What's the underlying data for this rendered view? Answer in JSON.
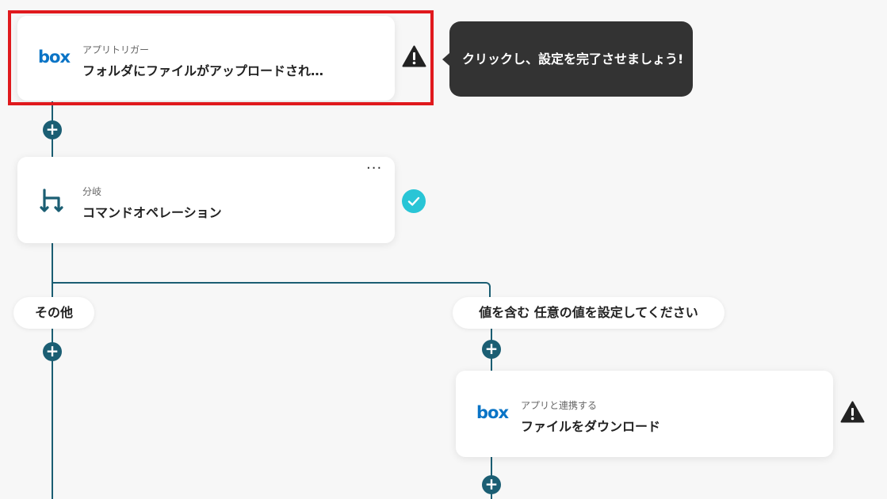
{
  "trigger_card": {
    "logo": "box",
    "subtitle": "アプリトリガー",
    "title": "フォルダにファイルがアップロードされ…"
  },
  "tooltip": {
    "text": "クリックし、設定を完了させましょう!"
  },
  "branch_card": {
    "icon": "branch-icon",
    "subtitle": "分岐",
    "title": "コマンドオペレーション",
    "menu": "···"
  },
  "branches": {
    "left_label": "その他",
    "right_label": "値を含む 任意の値を設定してください"
  },
  "download_card": {
    "logo": "box",
    "subtitle": "アプリと連携する",
    "title": "ファイルをダウンロード"
  },
  "add_step": "+",
  "colors": {
    "line": "#1b5e73",
    "box_brand": "#0a74c6",
    "warning": "#222222",
    "check": "#29c5d6",
    "highlight": "#e0191d",
    "tooltip_bg": "#333333"
  }
}
